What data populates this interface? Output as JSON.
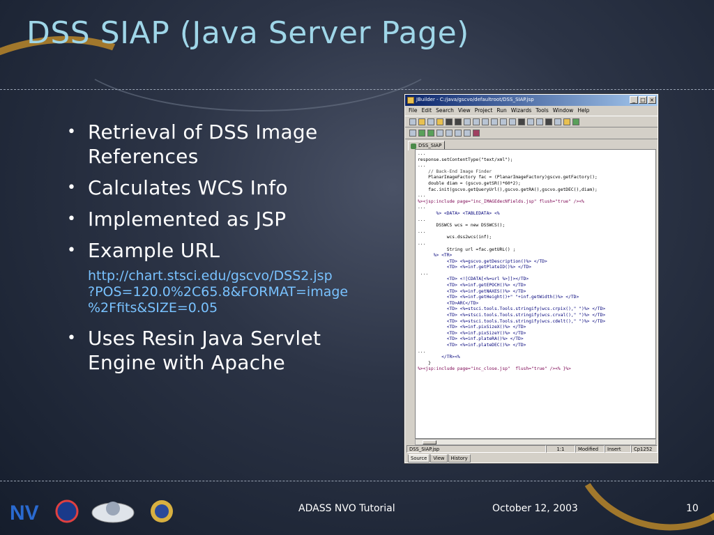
{
  "slide": {
    "title": "DSS SIAP (Java Server Page)",
    "bullets": [
      "Retrieval of DSS Image References",
      "Calculates WCS Info",
      "Implemented as JSP",
      "Example URL"
    ],
    "example_url_lines": [
      "http://chart.stsci.edu/gscvo/DSS2.jsp",
      "?POS=120.0%2C65.8&FORMAT=image",
      "%2Ffits&SIZE=0.05"
    ],
    "last_bullet": "Uses Resin Java Servlet Engine with Apache"
  },
  "ide": {
    "window_title": "JBuilder - C:/java/gscvo/defaultroot/DSS_SIAP.jsp",
    "menus": [
      "File",
      "Edit",
      "Search",
      "View",
      "Project",
      "Run",
      "Wizards",
      "Tools",
      "Window",
      "Help"
    ],
    "file_tab": "DSS_SIAP",
    "code_lines": [
      "...",
      "response.setContentType(\"text/xml\");",
      "...",
      "    // Back-End Image Finder",
      "    PlanarImageFactory fac = (PlanarImageFactory)gscvo.getFactory();",
      "    double diam = (gscvo.getSR()*60*2);",
      "    fac.init(gscvo.getQueryUrl(),gscvo.getRA(),gscvo.getDEC(),diam);",
      "...",
      "%><jsp:include page=\"inc_IMAGEdecNfields.jsp\" flush=\"true\" /><%",
      "...",
      "       %> <DATA> <TABLEDATA> <%",
      "...",
      "       DSSWCS wcs = new DSSWCS();",
      "...",
      "           wcs.dss2wcs(inf);",
      "...",
      "           String url =fac.getURL() ;",
      "      %> <TR>",
      "           <TD> <%=gscvo.getDescription()%> </TD>",
      "           <TD> <%=inf.getPlateID()%> </TD>",
      " ...",
      "           <TD> <![CDATA[<%=url %>]]></TD>",
      "           <TD> <%=inf.getEPOCH()%> </TD>",
      "           <TD> <%=inf.getNAXES()%> </TD>",
      "           <TD> <%=inf.getHeight()+\" \"+inf.getWidth()%> </TD>",
      "           <TD>ARC</TD>",
      "           <TD> <%=stsci.tools.Tools.stringify(wcs.crpix(),\" \")%> </TD>",
      "           <TD> <%=stsci.tools.Tools.stringify(wcs.crval(),\" \")%> </TD>",
      "           <TD> <%=stsci.tools.Tools.stringify(wcs.cdelt(),\" \")%> </TD>",
      "           <TD> <%=inf.pixSizeX()%> </TD>",
      "           <TD> <%=inf.pixSizeY()%> </TD>",
      "           <TD> <%=inf.plateRA()%> </TD>",
      "           <TD> <%=inf.plateDEC()%> </TD>",
      "...",
      "         </TR><%",
      "    }",
      "%><jsp:include page=\"inc_close.jsp\"  flush=\"true\" /><% }%>"
    ],
    "status": {
      "file": "DSS_SIAP.jsp",
      "position": "1:1",
      "modified": "Modified",
      "mode": "Insert",
      "encoding": "Cp1252"
    },
    "bottom_tabs": [
      "Source",
      "View",
      "History"
    ]
  },
  "footer": {
    "center": "ADASS NVO Tutorial",
    "date": "October 12, 2003",
    "page": "10"
  },
  "colors": {
    "title": "#9fd6e8",
    "link": "#79c2ff",
    "arc": "#d4a030"
  }
}
